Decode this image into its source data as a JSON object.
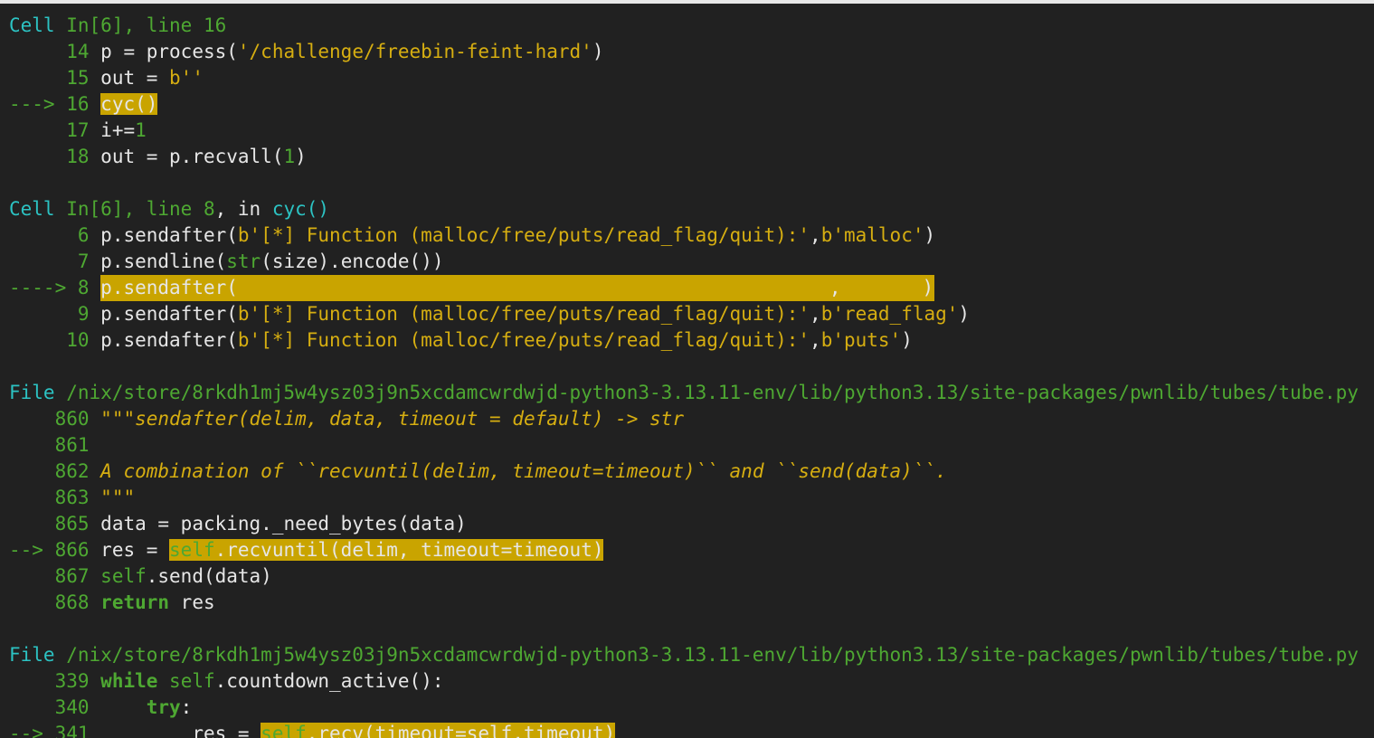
{
  "cells": [
    {
      "header": {
        "prefix": "Cell ",
        "ref": "In[6]",
        "sep": ", line 16"
      },
      "lines": [
        {
          "marker": "     ",
          "no": "14",
          "code": "p = process(",
          "str": "'/challenge/freebin-feint-hard'",
          "tail": ")"
        },
        {
          "marker": "     ",
          "no": "15",
          "code": "out = ",
          "str": "b''",
          "tail": ""
        },
        {
          "marker": "---> ",
          "no": "16",
          "hl": "cyc()"
        },
        {
          "marker": "     ",
          "no": "17",
          "code": "i+=",
          "num": "1"
        },
        {
          "marker": "     ",
          "no": "18",
          "code": "out = p.recvall(",
          "num": "1",
          "tail": ")"
        }
      ]
    },
    {
      "header": {
        "prefix": "Cell ",
        "ref": "In[6]",
        "sep": ", line ",
        "lineno": "8",
        "mid": ", in ",
        "func": "cyc",
        "paren": "()"
      },
      "lines": [
        {
          "no": "6",
          "pre": "p.sendafter(",
          "str": "b'[*] Function (malloc/free/puts/read_flag/quit):'",
          "comma": ",",
          "str2": "b'malloc'",
          "post": ")"
        },
        {
          "no": "7",
          "pre": "p.sendline(",
          "builtin": "str",
          "post": "(size).encode())"
        },
        {
          "marker": "----> ",
          "no": "8",
          "hl": "p.sendafter(",
          "hlcomma": ",",
          "hlend": ")"
        },
        {
          "no": "9",
          "pre": "p.sendafter(",
          "str": "b'[*] Function (malloc/free/puts/read_flag/quit):'",
          "comma": ",",
          "str2": "b'read_flag'",
          "post": ")"
        },
        {
          "no": "10",
          "pre": "p.sendafter(",
          "str": "b'[*] Function (malloc/free/puts/read_flag/quit):'",
          "comma": ",",
          "str2": "b'puts'",
          "post": ")"
        }
      ]
    }
  ],
  "file1": {
    "prefix": "File ",
    "path": "/nix/store/8rkdh1mj5w4ysz03j9n5xcdamcwrdwjd-python3-3.13.11-env/lib/python3.13/site-packages/pwnlib/tubes/tube.py",
    "lines": [
      {
        "no": "860",
        "doc": "\"\"\"sendafter(delim, data, timeout = default) -> str"
      },
      {
        "no": "861",
        "doc": ""
      },
      {
        "no": "862",
        "doc": "A combination of ``recvuntil(delim, timeout=timeout)`` and ``send(data)``."
      },
      {
        "no": "863",
        "doc": "\"\"\""
      },
      {
        "no": "865",
        "code": "data = packing._need_bytes(data)"
      },
      {
        "marker": "--> ",
        "no": "866",
        "code": "res = ",
        "hlself": "self",
        "hlrest": ".recvuntil(delim, timeout=timeout)"
      },
      {
        "no": "867",
        "self": "self",
        "code": ".send(data)"
      },
      {
        "no": "868",
        "kw": "return",
        "code": " res"
      }
    ]
  },
  "file2": {
    "prefix": "File ",
    "path": "/nix/store/8rkdh1mj5w4ysz03j9n5xcdamcwrdwjd-python3-3.13.11-env/lib/python3.13/site-packages/pwnlib/tubes/tube.py",
    "lines": [
      {
        "no": "339",
        "kw": "while",
        "self": "self",
        "code": ".countdown_active():"
      },
      {
        "no": "340",
        "kw": "try",
        "code": ":"
      },
      {
        "marker": "--> ",
        "no": "341",
        "code": "res = ",
        "hlself": "self",
        "hlrest": ".recv(timeout=self.timeout)"
      }
    ]
  }
}
